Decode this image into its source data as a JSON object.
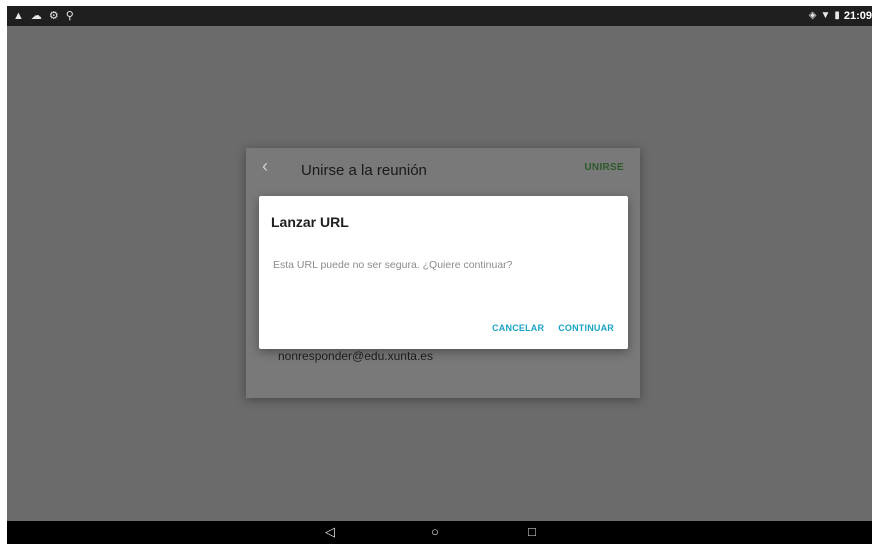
{
  "status_bar": {
    "left_icons": [
      "warning-icon",
      "cloud-icon",
      "settings-icon",
      "usb-icon"
    ],
    "right_icons": [
      "vibrate-icon",
      "wifi-icon",
      "battery-icon"
    ],
    "time": "21:09"
  },
  "join_panel": {
    "title": "Unirse a la reunión",
    "join_label": "UNIRSE",
    "email": "nonresponder@edu.xunta.es"
  },
  "dialog": {
    "title": "Lanzar URL",
    "message": "Esta URL puede no ser segura. ¿Quiere continuar?",
    "cancel_label": "CANCELAR",
    "continue_label": "CONTINUAR"
  },
  "nav_bar": {
    "items": [
      "back-icon",
      "home-icon",
      "recents-icon"
    ]
  },
  "colors": {
    "dialog_action": "#1ba3c6",
    "join_action": "#2d5a2a",
    "scrim": "#6b6b6b"
  }
}
